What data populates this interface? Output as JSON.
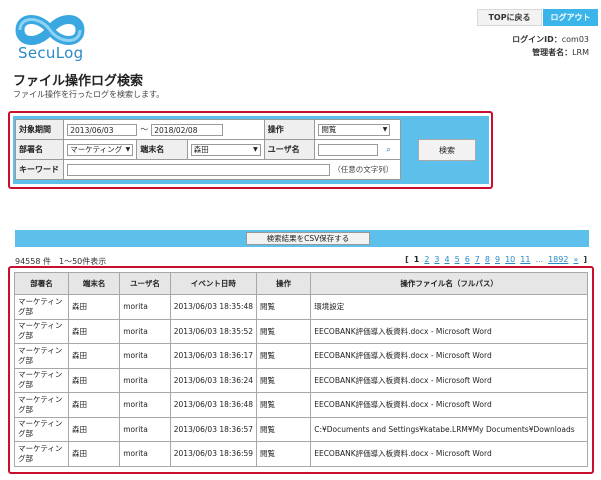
{
  "header": {
    "logo_text": "SecuLog",
    "top_link": "TOPに戻る",
    "logout": "ログアウト",
    "login_id_label": "ログインID：",
    "login_id": "com03",
    "admin_label": "管理者名：",
    "admin_name": "LRM"
  },
  "page": {
    "title": "ファイル操作ログ検索",
    "description": "ファイル操作を行ったログを検索します。"
  },
  "search": {
    "period_label": "対象期間",
    "period_from": "2013/06/03",
    "period_sep": "～",
    "period_to": "2018/02/08",
    "operation_label": "操作",
    "operation_value": "閲覧",
    "dept_label": "部署名",
    "dept_value": "マーケティング",
    "terminal_label": "端末名",
    "terminal_value": "森田",
    "user_label": "ユーザ名",
    "user_value": "",
    "keyword_label": "キーワード",
    "keyword_value": "",
    "keyword_hint": "（任意の文字列）",
    "search_button": "検索"
  },
  "csv_button": "検索結果をCSV保存する",
  "result_count": "94558 件　1〜50件表示",
  "pager": {
    "open": "[",
    "pages": [
      "1",
      "2",
      "3",
      "4",
      "5",
      "6",
      "7",
      "8",
      "9",
      "10",
      "11",
      "...",
      "1892",
      "»"
    ],
    "close": "]"
  },
  "results": {
    "headers": [
      "部署名",
      "端末名",
      "ユーザ名",
      "イベント日時",
      "操作",
      "操作ファイル名（フルパス）"
    ],
    "rows": [
      [
        "マーケティング部",
        "森田",
        "morita",
        "2013/06/03 18:35:48",
        "閲覧",
        "環境設定"
      ],
      [
        "マーケティング部",
        "森田",
        "morita",
        "2013/06/03 18:35:52",
        "閲覧",
        "EECOBANK評価導入板資料.docx - Microsoft Word"
      ],
      [
        "マーケティング部",
        "森田",
        "morita",
        "2013/06/03 18:36:17",
        "閲覧",
        "EECOBANK評価導入板資料.docx - Microsoft Word"
      ],
      [
        "マーケティング部",
        "森田",
        "morita",
        "2013/06/03 18:36:24",
        "閲覧",
        "EECOBANK評価導入板資料.docx - Microsoft Word"
      ],
      [
        "マーケティング部",
        "森田",
        "morita",
        "2013/06/03 18:36:48",
        "閲覧",
        "EECOBANK評価導入板資料.docx - Microsoft Word"
      ],
      [
        "マーケティング部",
        "森田",
        "morita",
        "2013/06/03 18:36:57",
        "閲覧",
        "C:¥Documents and Settings¥katabe.LRM¥My Documents¥Downloads"
      ],
      [
        "マーケティング部",
        "森田",
        "morita",
        "2013/06/03 18:36:59",
        "閲覧",
        "EECOBANK評価導入板資料.docx - Microsoft Word"
      ]
    ]
  },
  "colors": {
    "accent": "#5cc0ea",
    "highlight": "#c8102e",
    "logo": "#2a8ac8"
  }
}
